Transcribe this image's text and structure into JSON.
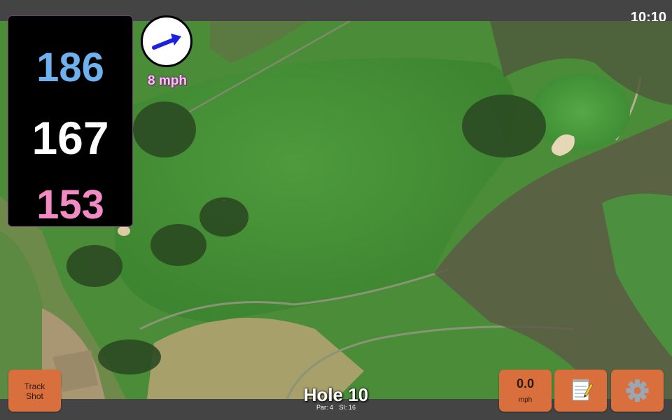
{
  "status": {
    "time": "10:10"
  },
  "distances": {
    "back": "186",
    "middle": "167",
    "front": "153"
  },
  "wind": {
    "speed": "8 mph",
    "direction_icon": "wind-arrow"
  },
  "buttons": {
    "track_shot": {
      "line1": "Track",
      "line2": "Shot"
    },
    "speed": {
      "value": "0.0",
      "unit": "mph"
    },
    "notes_icon": "notepad-icon",
    "settings_icon": "gear-icon"
  },
  "hole": {
    "title": "Hole 10",
    "par": "Par: 4",
    "si": "SI: 16"
  },
  "colors": {
    "back_distance": "#6fb1ee",
    "middle_distance": "#ffffff",
    "front_distance": "#f28ac4",
    "button": "#d96f3c",
    "wind_arrow": "#1a22e0"
  }
}
